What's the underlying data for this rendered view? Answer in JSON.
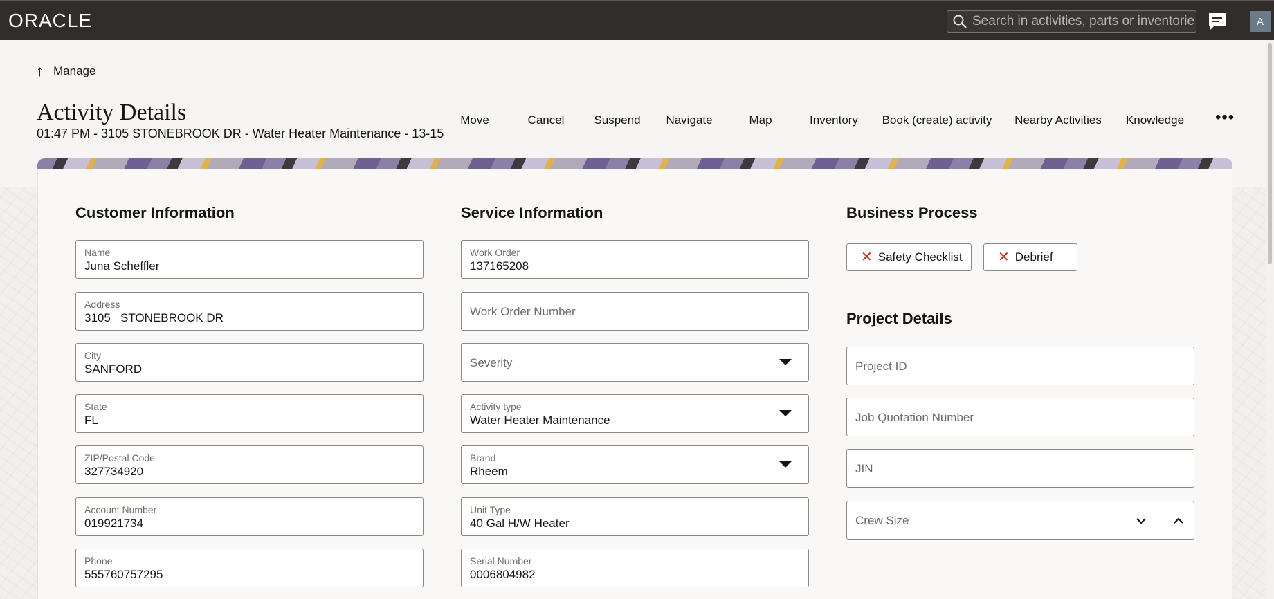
{
  "topbar": {
    "logo": "ORACLE",
    "search_placeholder": "Search in activities, parts or inventories",
    "avatar_initial": "A"
  },
  "breadcrumb": {
    "label": "Manage"
  },
  "page": {
    "title": "Activity Details",
    "subtitle": "01:47 PM - 3105 STONEBROOK DR - Water Heater Maintenance - 13-15"
  },
  "actions": {
    "move": "Move",
    "cancel": "Cancel",
    "suspend": "Suspend",
    "navigate": "Navigate",
    "map": "Map",
    "inventory": "Inventory",
    "book": "Book (create) activity",
    "nearby": "Nearby Activities",
    "knowledge": "Knowledge"
  },
  "customer": {
    "title": "Customer Information",
    "fields": {
      "name": {
        "label": "Name",
        "value": "Juna Scheffler"
      },
      "address": {
        "label": "Address",
        "value": "3105   STONEBROOK DR"
      },
      "city": {
        "label": "City",
        "value": "SANFORD"
      },
      "state": {
        "label": "State",
        "value": "FL"
      },
      "zip": {
        "label": "ZIP/Postal Code",
        "value": "327734920"
      },
      "account": {
        "label": "Account Number",
        "value": "019921734"
      },
      "phone": {
        "label": "Phone",
        "value": "555760757295"
      }
    }
  },
  "service": {
    "title": "Service Information",
    "fields": {
      "work_order": {
        "label": "Work Order",
        "value": "137165208"
      },
      "work_order_number": {
        "placeholder": "Work Order Number"
      },
      "severity": {
        "placeholder": "Severity"
      },
      "activity_type": {
        "label": "Activity type",
        "value": "Water Heater Maintenance"
      },
      "brand": {
        "label": "Brand",
        "value": "Rheem"
      },
      "unit_type": {
        "label": "Unit Type",
        "value": "40 Gal H/W Heater"
      },
      "serial": {
        "label": "Serial Number",
        "value": "0006804982"
      }
    }
  },
  "business_process": {
    "title": "Business Process",
    "safety_checklist": "Safety Checklist",
    "debrief": "Debrief"
  },
  "project": {
    "title": "Project Details",
    "project_id": "Project ID",
    "job_quotation": "Job Quotation Number",
    "jin": "JIN",
    "crew_size": "Crew Size"
  },
  "colors": {
    "topbar": "#312d2a",
    "error_x": "#c0281b",
    "avatar": "#6d7b88"
  }
}
